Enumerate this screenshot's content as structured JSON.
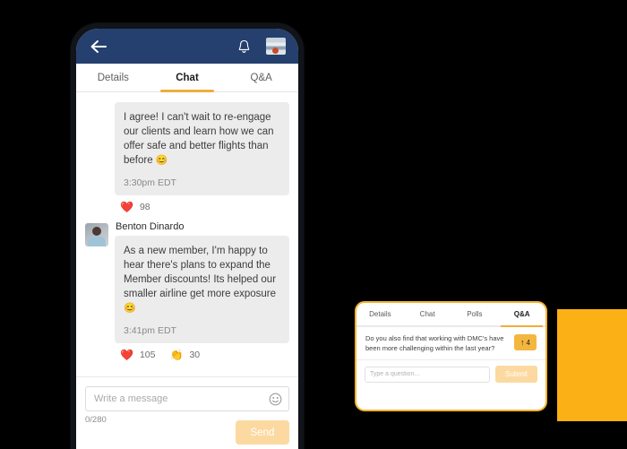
{
  "colors": {
    "header_blue": "#25406E",
    "accent_amber": "#F0AD3C",
    "block_orange": "#FBB016",
    "bubble_gray": "#ECECEC",
    "disabled_button": "#FBD9A0",
    "upvote_amber": "#F3B63F"
  },
  "phone": {
    "header": {
      "back_icon": "back-arrow-icon",
      "bell_icon": "bell-icon",
      "thumbnail_icon": "event-thumbnail"
    },
    "tabs": [
      {
        "label": "Details",
        "active": false
      },
      {
        "label": "Chat",
        "active": true
      },
      {
        "label": "Q&A",
        "active": false
      }
    ],
    "messages": [
      {
        "sender": "",
        "has_avatar": false,
        "text": "I agree! I can't wait to re-engage our clients and learn how we can offer safe and better flights than before ",
        "emoji": "😊",
        "time": "3:30pm EDT",
        "reactions": [
          {
            "emoji": "❤️",
            "name": "heart-reaction",
            "count": "98"
          }
        ]
      },
      {
        "sender": "Benton Dinardo",
        "has_avatar": true,
        "text": "As a new member, I'm happy to hear there's plans to expand the Member discounts! Its helped our smaller airline get more exposure ",
        "emoji": "😊",
        "time": "3:41pm EDT",
        "reactions": [
          {
            "emoji": "❤️",
            "name": "heart-reaction",
            "count": "105"
          },
          {
            "emoji": "👏",
            "name": "clap-reaction",
            "count": "30"
          }
        ]
      }
    ],
    "composer": {
      "placeholder": "Write a message",
      "value": "",
      "emoji_icon": "smiley-icon",
      "counter": "0/280",
      "send_label": "Send"
    }
  },
  "qa_card": {
    "tabs": [
      {
        "label": "Details",
        "active": false
      },
      {
        "label": "Chat",
        "active": false
      },
      {
        "label": "Polls",
        "active": false
      },
      {
        "label": "Q&A",
        "active": true
      }
    ],
    "question": "Do you also find that working with DMC's have been more challenging within the last year?",
    "upvote": {
      "arrow": "↑",
      "count": "4"
    },
    "input_placeholder": "Type a question...",
    "input_value": "",
    "submit_label": "Submit"
  }
}
